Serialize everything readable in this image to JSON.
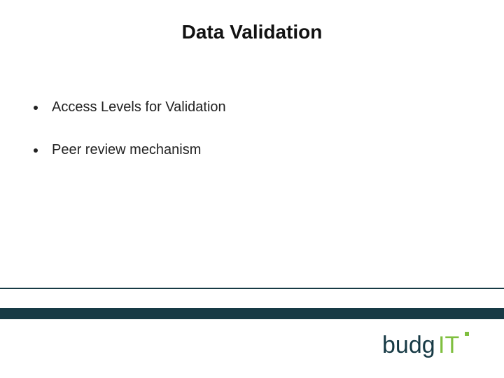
{
  "title": "Data Validation",
  "bullets": [
    "Access Levels  for Validation",
    "Peer review mechanism"
  ],
  "logo": {
    "name": "budgIT",
    "text_dark": "budg",
    "text_green": "IT",
    "colors": {
      "dark": "#173a45",
      "green": "#7fbf3f"
    }
  }
}
